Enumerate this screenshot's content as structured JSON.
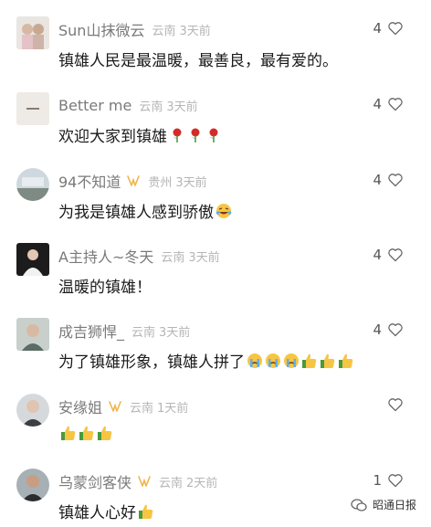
{
  "comments": [
    {
      "user": "Sun山抹微云",
      "loc": "云南",
      "time": "3天前",
      "likes": "4",
      "text": "镇雄人民是最温暖，最善良，最有爱的。",
      "badge": false,
      "emojis": []
    },
    {
      "user": "Better me",
      "loc": "云南",
      "time": "3天前",
      "likes": "4",
      "text": "欢迎大家到镇雄",
      "badge": false,
      "emojis": [
        "rose-emoji",
        "rose-emoji",
        "rose-emoji"
      ]
    },
    {
      "user": "94不知道",
      "loc": "贵州",
      "time": "3天前",
      "likes": "4",
      "text": "为我是镇雄人感到骄傲",
      "badge": true,
      "emojis": [
        "laughing-tears-emoji"
      ]
    },
    {
      "user": "A主持人~冬天",
      "loc": "云南",
      "time": "3天前",
      "likes": "4",
      "text": "温暖的镇雄！",
      "badge": false,
      "emojis": []
    },
    {
      "user": "成吉狮悍_",
      "loc": "云南",
      "time": "3天前",
      "likes": "4",
      "text": "为了镇雄形象，镇雄人拼了",
      "badge": false,
      "emojis": [
        "crying-emoji",
        "crying-emoji",
        "crying-emoji",
        "thumbs-up-emoji",
        "thumbs-up-emoji",
        "thumbs-up-emoji"
      ]
    },
    {
      "user": "安缘姐",
      "loc": "云南",
      "time": "1天前",
      "likes": "",
      "text": "",
      "badge": true,
      "emojis": [
        "thumbs-up-emoji",
        "thumbs-up-emoji",
        "thumbs-up-emoji"
      ]
    },
    {
      "user": "乌蒙剑客侠",
      "loc": "云南",
      "time": "2天前",
      "likes": "1",
      "text": "镇雄人心好",
      "badge": true,
      "emojis": [
        "thumbs-up-emoji"
      ]
    }
  ],
  "watermark": "昭通日报",
  "colors": {
    "username": "#7a7a7a",
    "meta": "#b5b5b5",
    "text": "#1a1a1a",
    "badge": "#f2b44a",
    "heart": "#666666"
  }
}
